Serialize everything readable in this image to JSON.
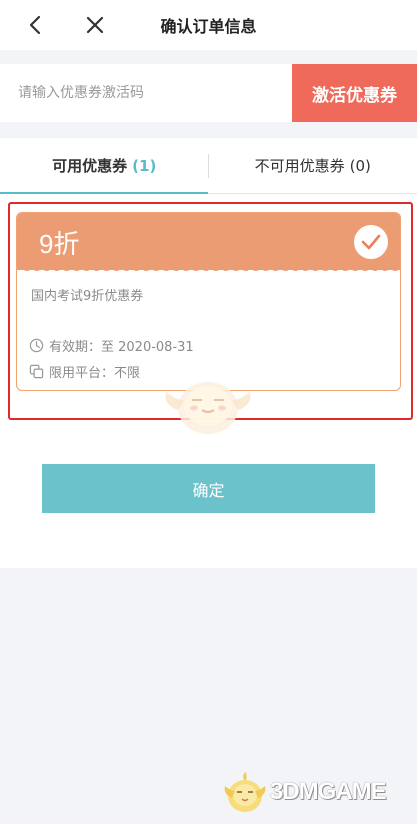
{
  "header": {
    "title": "确认订单信息",
    "back_icon": "back-arrow-icon",
    "close_icon": "close-icon"
  },
  "promo": {
    "placeholder": "请输入优惠券激活码",
    "activate_label": "激活优惠券"
  },
  "tabs": [
    {
      "label": "可用优惠券",
      "count": "(1)",
      "active": true
    },
    {
      "label": "不可用优惠券",
      "count": "(0)",
      "active": false
    }
  ],
  "coupon": {
    "discount": "9折",
    "name": "国内考试9折优惠券",
    "validity": "有效期：至 2020-08-31",
    "platform": "限用平台：不限",
    "selected": true
  },
  "confirm_label": "确定",
  "watermark": "3DMGAME",
  "colors": {
    "accent": "#5bbcc7",
    "confirm_button": "#6cc2cb",
    "activate_button": "#ef6a5a",
    "coupon_header": "#ec9c72",
    "highlight_border": "#e02a2a"
  }
}
